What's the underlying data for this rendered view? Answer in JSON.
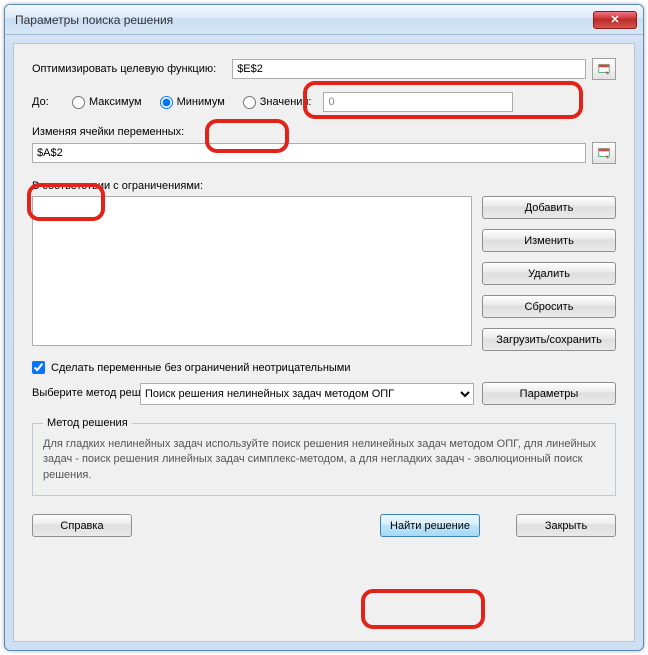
{
  "window": {
    "title": "Параметры поиска решения"
  },
  "labels": {
    "objective": "Оптимизировать целевую функцию:",
    "to": "До:",
    "max": "Максимум",
    "min": "Минимум",
    "value_of": "Значения:",
    "changing": "Изменяя ячейки переменных:",
    "constraints": "В соответствии с ограничениями:",
    "nonneg": "Сделать переменные без ограничений неотрицательными",
    "method_label": "Выберите метод решения:",
    "method_group": "Метод решения",
    "method_desc": "Для гладких нелинейных задач используйте поиск решения нелинейных задач методом ОПГ, для линейных задач - поиск решения линейных задач симплекс-методом, а для негладких задач - эволюционный поиск решения."
  },
  "inputs": {
    "objective_cell": "$E$2",
    "value_of": "0",
    "changing_cells": "$A$2",
    "method_selected": "Поиск решения нелинейных задач методом ОПГ"
  },
  "buttons": {
    "add": "Добавить",
    "change": "Изменить",
    "delete": "Удалить",
    "reset": "Сбросить",
    "load_save": "Загрузить/сохранить",
    "options": "Параметры",
    "help": "Справка",
    "solve": "Найти решение",
    "close": "Закрыть"
  },
  "state": {
    "radio_selected": "min",
    "nonneg_checked": true
  }
}
